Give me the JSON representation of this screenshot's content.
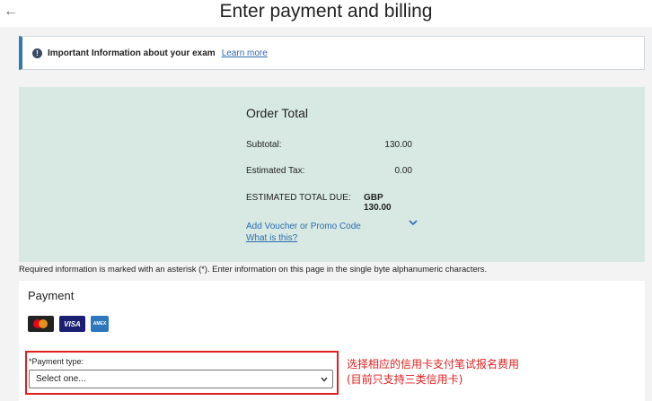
{
  "header": {
    "title": "Enter payment and billing",
    "back_icon": "arrow-left-icon"
  },
  "info_banner": {
    "text": "Important Information about your exam",
    "link": "Learn more",
    "icon": "info-icon"
  },
  "order": {
    "title": "Order Total",
    "subtotal_label": "Subtotal:",
    "subtotal_value": "130.00",
    "tax_label": "Estimated Tax:",
    "tax_value": "0.00",
    "due_label": "ESTIMATED TOTAL DUE:",
    "due_value": "GBP 130.00",
    "voucher_link": "Add Voucher or Promo Code",
    "whatis_link": "What is this?"
  },
  "required_note": "Required information is marked with an asterisk (*). Enter information on this page in the single byte alphanumeric characters.",
  "payment": {
    "title": "Payment",
    "cards": [
      "mastercard-icon",
      "visa-icon",
      "amex-icon"
    ],
    "visa_text": "VISA",
    "amex_text": "AMEX",
    "payment_type_label": "*Payment type:",
    "payment_type_selected": "Select one..."
  },
  "annotation": {
    "line1": "选择相应的信用卡支付笔试报名费用",
    "line2": "(目前只支持三类信用卡)"
  },
  "colors": {
    "accent": "#2f7bb0",
    "order_bg": "#d7e9e2",
    "annotation": "#e02020",
    "link": "#2f6bb0"
  }
}
